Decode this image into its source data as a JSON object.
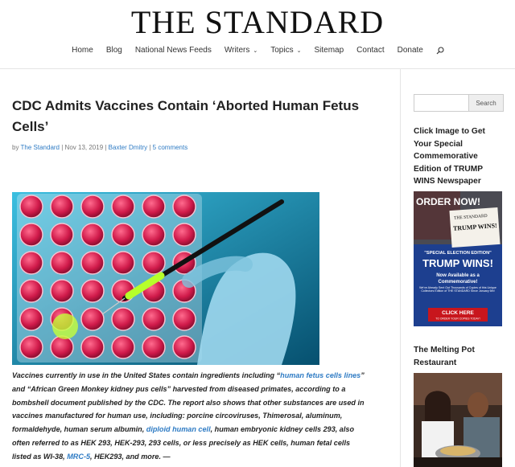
{
  "site": {
    "logo": "THE STANDARD"
  },
  "nav": {
    "items": [
      {
        "label": "Home"
      },
      {
        "label": "Blog"
      },
      {
        "label": "National News Feeds"
      },
      {
        "label": "Writers"
      },
      {
        "label": "Topics"
      },
      {
        "label": "Sitemap"
      },
      {
        "label": "Contact"
      },
      {
        "label": "Donate"
      }
    ],
    "search_icon": "search-icon"
  },
  "article": {
    "title": "CDC Admits Vaccines Contain ‘Aborted Human Fetus Cells’",
    "meta": {
      "by": "by",
      "author": "The Standard",
      "sep1": " | ",
      "date": "Nov 13, 2019",
      "sep2": " | ",
      "category": "Baxter Dmitry",
      "sep3": " | ",
      "comments": "5 comments"
    },
    "body": {
      "t1": "Vaccines currently in use in the United States contain ingredients including “",
      "l1": "human fetus cells lines",
      "t2": "” and “African Green Monkey kidney pus cells” harvested from diseased primates, according to a bombshell document published by the CDC. The report also shows that other substances are used in vaccines manufactured for human use, including: porcine circoviruses, Thimerosal, aluminum, formaldehyde, human serum albumin, ",
      "l2": "diploid human cell",
      "t3": ", human embryonic kidney cells 293, also often referred to as HEK 293, HEK-293, 293 cells, or less precisely as HEK cells, human fetal cells listed as WI-38, ",
      "l3": "MRC-5",
      "t4": ", HEK293, and more. —"
    }
  },
  "sidebar": {
    "search": {
      "placeholder": "",
      "button": "Search"
    },
    "promo": {
      "title": "Click Image to Get Your Special Commemorative Edition of TRUMP WINS Newspaper",
      "image": {
        "order_now": "ORDER NOW!",
        "masthead": "THE STANDARD",
        "headline": "TRUMP WINS!",
        "special": "\"SPECIAL ELECTION EDITION\"",
        "big": "TRUMP WINS!",
        "sub1": "Now Available as a",
        "sub2": "Commemorative!",
        "fine": "We've Already Sent Out Thousands of Copies of this Unique Collectors Edition of THE STANDARD Since January 6th!",
        "cta": "CLICK HERE",
        "cta_sub": "TO ORDER YOUR COPIES TODAY!"
      }
    },
    "melting_pot": {
      "title": "The Melting Pot Restaurant"
    }
  },
  "colors": {
    "link": "#2e7bc4",
    "promo_blue": "#1d3f8f",
    "promo_red": "#c8161d"
  }
}
